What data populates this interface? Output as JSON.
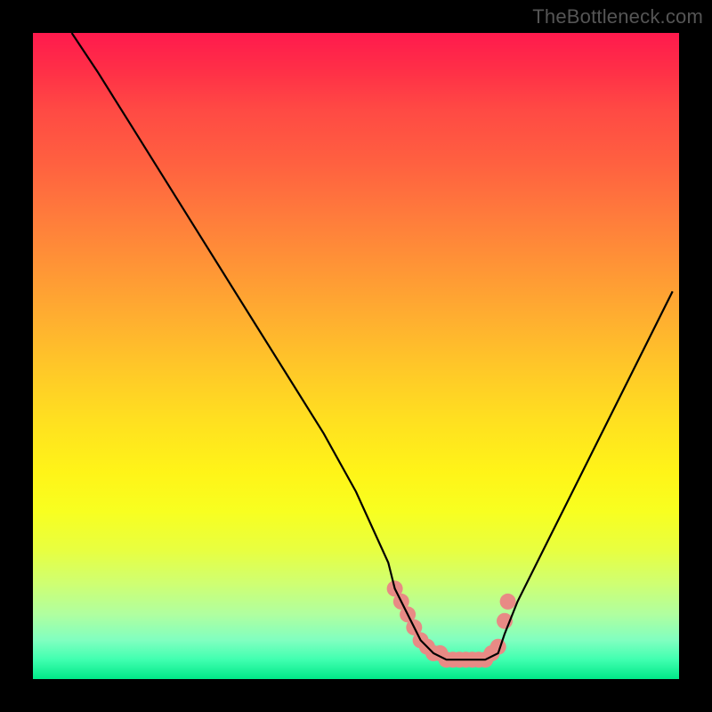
{
  "watermark": "TheBottleneck.com",
  "chart_data": {
    "type": "line",
    "title": "",
    "xlabel": "",
    "ylabel": "",
    "xlim": [
      0,
      100
    ],
    "ylim": [
      0,
      100
    ],
    "series": [
      {
        "name": "curve",
        "x": [
          6,
          10,
          15,
          20,
          25,
          30,
          35,
          40,
          45,
          50,
          55,
          56,
          58,
          60,
          62,
          64,
          66,
          68,
          70,
          72,
          73,
          75,
          80,
          85,
          90,
          95,
          99
        ],
        "values": [
          100,
          94,
          86,
          78,
          70,
          62,
          54,
          46,
          38,
          29,
          18,
          14,
          10,
          6,
          4,
          3,
          3,
          3,
          3,
          4,
          7,
          12,
          22,
          32,
          42,
          52,
          60
        ]
      }
    ],
    "markers": {
      "name": "highlight-dots",
      "color": "#e88a85",
      "points": [
        {
          "x": 56,
          "y": 14
        },
        {
          "x": 57,
          "y": 12
        },
        {
          "x": 58,
          "y": 10
        },
        {
          "x": 59,
          "y": 8
        },
        {
          "x": 60,
          "y": 6
        },
        {
          "x": 61,
          "y": 5
        },
        {
          "x": 62,
          "y": 4
        },
        {
          "x": 63,
          "y": 4
        },
        {
          "x": 64,
          "y": 3
        },
        {
          "x": 65,
          "y": 3
        },
        {
          "x": 66,
          "y": 3
        },
        {
          "x": 67,
          "y": 3
        },
        {
          "x": 68,
          "y": 3
        },
        {
          "x": 69,
          "y": 3
        },
        {
          "x": 70,
          "y": 3
        },
        {
          "x": 71,
          "y": 4
        },
        {
          "x": 72,
          "y": 5
        },
        {
          "x": 73,
          "y": 9
        },
        {
          "x": 73.5,
          "y": 12
        }
      ]
    },
    "background_gradient": {
      "top": "#ff1a4d",
      "bottom": "#00e888"
    }
  }
}
